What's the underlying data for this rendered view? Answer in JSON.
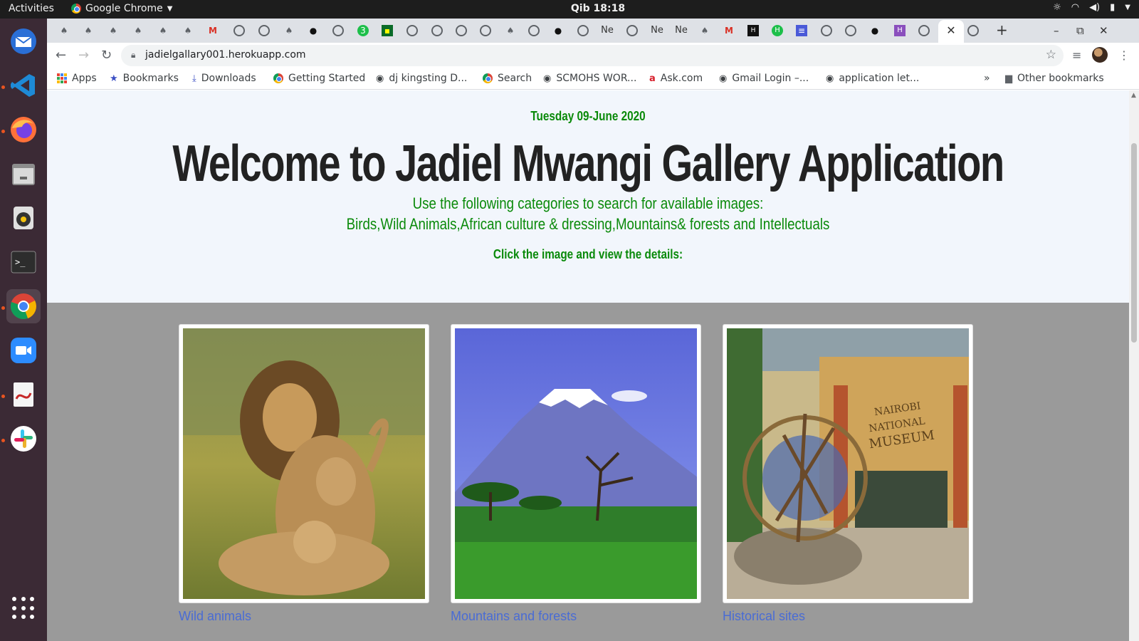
{
  "topbar": {
    "activities": "Activities",
    "app_name": "Google Chrome",
    "clock": "Qib 18:18"
  },
  "tabs": {
    "text_tabs": [
      "Ne",
      "Ne",
      "Ne"
    ],
    "active_close": "✕"
  },
  "toolbar": {
    "url": "jadielgallary001.herokuapp.com"
  },
  "bookmarks": {
    "apps": "Apps",
    "items": [
      "Bookmarks",
      "Downloads",
      "Getting Started",
      "dj kingsting D...",
      "Search",
      "SCMOHS WOR...",
      "Ask.com",
      "Gmail Login –...",
      "application let..."
    ],
    "overflow": "»",
    "other": "Other bookmarks"
  },
  "page": {
    "date": "Tuesday 09-June 2020",
    "title": "Welcome to Jadiel Mwangi Gallery Application",
    "subtitle_1": "Use the following categories to search for available images:",
    "subtitle_2": "Birds,Wild Animals,African culture & dressing,Mountains& forests and Intellectuals",
    "instruction": "Click the image and view the details:",
    "cards": [
      {
        "label": "Wild animals",
        "image": "lions"
      },
      {
        "label": "Mountains and forests",
        "image": "mount-kilimanjaro"
      },
      {
        "label": "Historical sites",
        "image": "nairobi-national-museum",
        "sign": "NAIROBI NATIONAL MUSEUM"
      }
    ]
  },
  "colors": {
    "page_bg": "#f2f6fc",
    "gallery_bg": "#9a9a9a",
    "green_text": "#0a8a0a",
    "link": "#4a6cd4"
  }
}
